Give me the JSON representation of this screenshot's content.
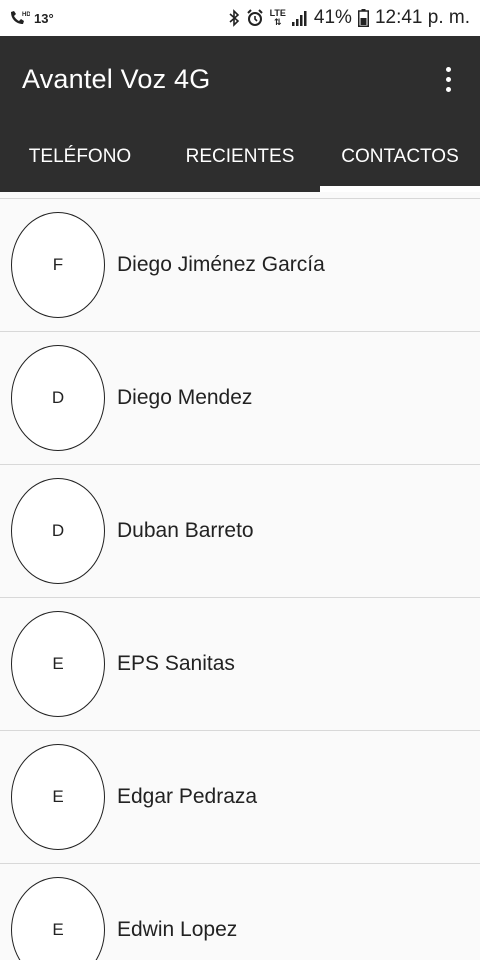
{
  "status_bar": {
    "temperature": "13°",
    "network": "LTE",
    "battery": "41%",
    "time": "12:41 p. m."
  },
  "app_bar": {
    "title": "Avantel Voz 4G",
    "overflow_icon": "more-vertical-icon"
  },
  "tabs": [
    {
      "label": "TELÉFONO",
      "active": false
    },
    {
      "label": "RECIENTES",
      "active": false
    },
    {
      "label": "CONTACTOS",
      "active": true
    }
  ],
  "contacts": [
    {
      "initial": "F",
      "name": "Diego Jiménez García"
    },
    {
      "initial": "D",
      "name": "Diego Mendez"
    },
    {
      "initial": "D",
      "name": "Duban Barreto"
    },
    {
      "initial": "E",
      "name": "EPS Sanitas"
    },
    {
      "initial": "E",
      "name": "Edgar Pedraza"
    },
    {
      "initial": "E",
      "name": "Edwin Lopez"
    }
  ],
  "colors": {
    "app_bar": "#2e2e2e",
    "list_background": "#fafafa",
    "divider": "#d8d8d8"
  }
}
